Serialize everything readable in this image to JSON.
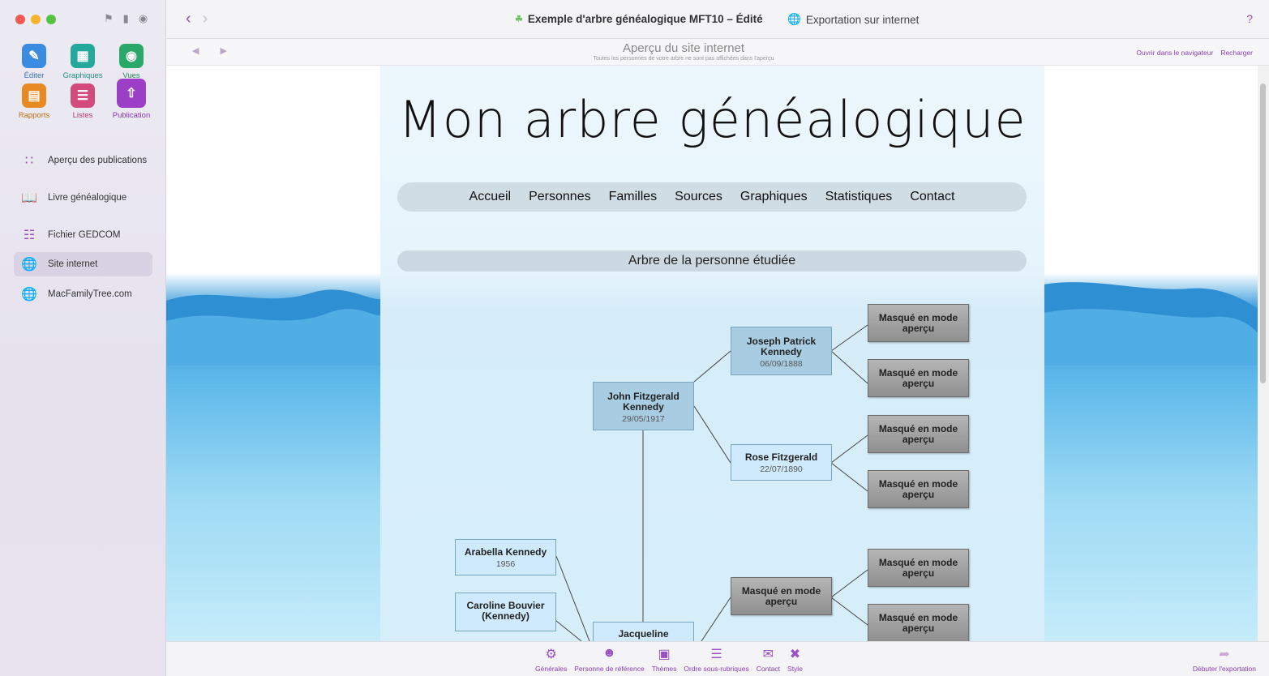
{
  "window": {
    "title": "Exemple d'arbre généalogique MFT10 – Édité",
    "export_label": "Exportation sur internet",
    "help": "?"
  },
  "sidebar": {
    "tools": [
      {
        "label": "Éditer",
        "icon": "pencil-icon",
        "color": "#3b8be0"
      },
      {
        "label": "Graphiques",
        "icon": "chart-tree-icon",
        "color": "#23a89b"
      },
      {
        "label": "Vues",
        "icon": "eye-icon",
        "color": "#2aa86a"
      },
      {
        "label": "Rapports",
        "icon": "report-icon",
        "color": "#e88a24"
      },
      {
        "label": "Listes",
        "icon": "list-icon",
        "color": "#d24b7c"
      },
      {
        "label": "Publication",
        "icon": "publish-icon",
        "color": "#9b3fc6"
      }
    ],
    "items": [
      {
        "label": "Aperçu des publications",
        "icon": "grid-icon"
      },
      {
        "label": "Livre généalogique",
        "icon": "book-icon"
      },
      {
        "label": "Fichier GEDCOM",
        "icon": "gedcom-file-icon"
      },
      {
        "label": "Site internet",
        "icon": "globe-icon",
        "active": true
      },
      {
        "label": "MacFamilyTree.com",
        "icon": "globe-icon"
      }
    ]
  },
  "preview": {
    "title": "Aperçu du site internet",
    "subtitle": "Toutes les personnes de votre arbre ne sont pas affichées dans l'aperçu",
    "open_browser": "Ouvrir dans le navigateur",
    "reload": "Recharger"
  },
  "site": {
    "title": "Mon arbre généalogique",
    "menu": [
      "Accueil",
      "Personnes",
      "Familles",
      "Sources",
      "Graphiques",
      "Statistiques",
      "Contact"
    ],
    "section": "Arbre de la personne étudiée",
    "hidden_label": "Masqué en mode aperçu",
    "persons": {
      "main": {
        "name": "John Fitzgerald Kennedy",
        "date": "29/05/1917"
      },
      "father": {
        "name": "Joseph Patrick Kennedy",
        "date": "06/09/1888"
      },
      "mother": {
        "name": "Rose Fitzgerald",
        "date": "22/07/1890"
      },
      "child1": {
        "name": "Arabella Kennedy",
        "date": "1956"
      },
      "child2": {
        "name": "Caroline Bouvier (Kennedy)",
        "date": ""
      },
      "spouse": {
        "name": "Jacqueline",
        "date": ""
      }
    }
  },
  "bottombar": {
    "items": [
      {
        "label": "Générales",
        "icon": "gear-icon"
      },
      {
        "label": "Personne de référence",
        "icon": "person-icon"
      },
      {
        "label": "Thèmes",
        "icon": "theme-icon"
      },
      {
        "label": "Ordre sous-rubriques",
        "icon": "order-list-icon"
      },
      {
        "label": "Contact",
        "icon": "envelope-icon"
      },
      {
        "label": "Style",
        "icon": "style-tools-icon"
      }
    ],
    "start_export": "Débuter l'exportation"
  },
  "colors": {
    "accent": "#9b4fc4",
    "node_blue": "#a8cde3",
    "node_light": "#cfeafc",
    "node_hidden": "#9f9f9f"
  }
}
